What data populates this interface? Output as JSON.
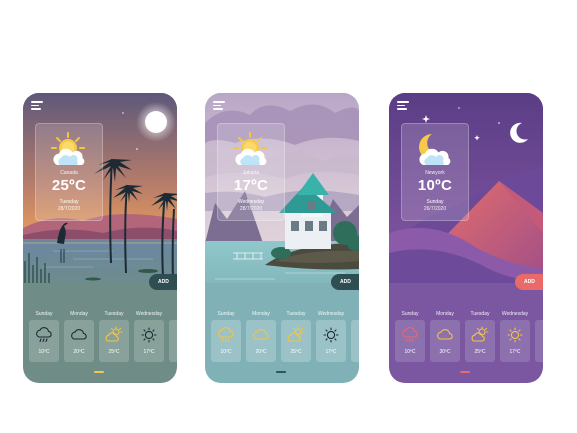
{
  "phones": [
    {
      "city": "Canada",
      "temp": "25ºC",
      "day": "Tuesday",
      "date": "28/7/2020",
      "add_label": "ADD",
      "weather_icon": "sun-cloud-icon",
      "forecast": [
        {
          "day": "Sunday",
          "temp": "10ºC",
          "icon": "rain-cloud-icon"
        },
        {
          "day": "Monday",
          "temp": "20ºC",
          "icon": "cloud-icon"
        },
        {
          "day": "Tuesday",
          "temp": "25ºC",
          "icon": "partly-cloudy-icon"
        },
        {
          "day": "Wednesday",
          "temp": "17ºC",
          "icon": "sun-icon"
        },
        {
          "day": "T",
          "temp": "",
          "icon": ""
        }
      ]
    },
    {
      "city": "Jakarta",
      "temp": "17ºC",
      "day": "Wednesday",
      "date": "28/7/2020",
      "add_label": "ADD",
      "weather_icon": "sun-cloud-icon",
      "forecast": [
        {
          "day": "Sunday",
          "temp": "10ºC",
          "icon": "rain-cloud-icon"
        },
        {
          "day": "Monday",
          "temp": "20ºC",
          "icon": "cloud-icon"
        },
        {
          "day": "Tuesday",
          "temp": "25ºC",
          "icon": "partly-cloudy-icon"
        },
        {
          "day": "Wednesday",
          "temp": "17ºC",
          "icon": "sun-icon"
        },
        {
          "day": "T",
          "temp": "",
          "icon": ""
        }
      ]
    },
    {
      "city": "Newyork",
      "temp": "10ºC",
      "day": "Sunday",
      "date": "26/7/2020",
      "add_label": "ADD",
      "weather_icon": "moon-cloud-icon",
      "forecast": [
        {
          "day": "Sunday",
          "temp": "10ºC",
          "icon": "rain-cloud-icon"
        },
        {
          "day": "Monday",
          "temp": "30ºC",
          "icon": "cloud-icon"
        },
        {
          "day": "Tuesday",
          "temp": "25ºC",
          "icon": "partly-cloudy-icon"
        },
        {
          "day": "Wednesday",
          "temp": "17ºC",
          "icon": "sun-icon"
        },
        {
          "day": "T",
          "temp": "",
          "icon": ""
        }
      ]
    }
  ],
  "colors": {
    "sunny_icon": "#f6c443",
    "evening_bg": "#6f8d86",
    "day_bg": "#7fb1b6",
    "night_bg": "#7a57a0",
    "add_dark": "#2e4e52",
    "add_coral": "#ea6a6a"
  }
}
